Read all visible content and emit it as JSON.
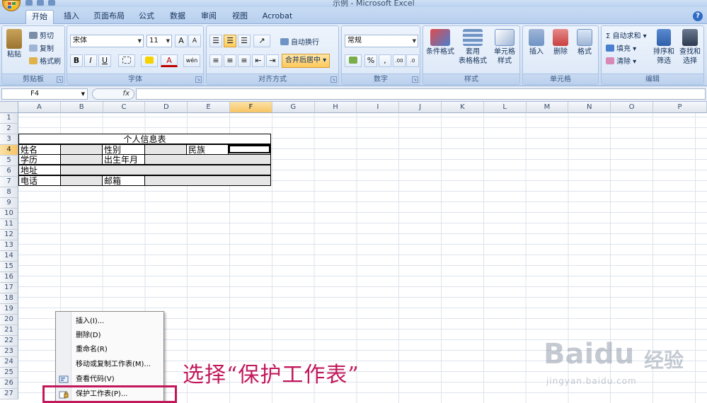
{
  "window": {
    "title": "示例 - Microsoft Excel"
  },
  "tabs": [
    {
      "label": "开始",
      "active": true
    },
    {
      "label": "插入"
    },
    {
      "label": "页面布局"
    },
    {
      "label": "公式"
    },
    {
      "label": "数据"
    },
    {
      "label": "审阅"
    },
    {
      "label": "视图"
    },
    {
      "label": "Acrobat"
    }
  ],
  "help_label": "?",
  "ribbon": {
    "clipboard": {
      "label": "剪贴板",
      "paste": "粘贴",
      "cut": "剪切",
      "copy": "复制",
      "format_painter": "格式刷"
    },
    "font": {
      "label": "字体",
      "font_name": "宋体",
      "font_size": "11",
      "bold": "B",
      "italic": "I",
      "underline": "U",
      "grow": "A",
      "shrink": "A",
      "font_color": "A",
      "phonetic": "wén"
    },
    "alignment": {
      "label": "对齐方式",
      "wrap_text": "自动换行",
      "merge_center": "合并后居中"
    },
    "number": {
      "label": "数字",
      "format": "常规",
      "percent": "%",
      "comma": ",",
      "inc_decimal": ".00",
      "dec_decimal": ".0"
    },
    "styles": {
      "label": "样式",
      "conditional": "条件格式",
      "table_line1": "套用",
      "table_line2": "表格格式",
      "cell_line1": "单元格",
      "cell_line2": "样式"
    },
    "cells": {
      "label": "单元格",
      "insert": "插入",
      "delete": "删除",
      "format": "格式"
    },
    "editing": {
      "label": "编辑",
      "autosum": "自动求和",
      "fill": "填充",
      "clear": "清除",
      "sort_line1": "排序和",
      "sort_line2": "筛选",
      "find_line1": "查找和",
      "find_line2": "选择"
    }
  },
  "formula_bar": {
    "name_box": "F4",
    "fx": "fx",
    "content": ""
  },
  "columns": [
    "A",
    "B",
    "C",
    "D",
    "E",
    "F",
    "G",
    "H",
    "I",
    "J",
    "K",
    "L",
    "M",
    "N",
    "O",
    "P"
  ],
  "selected_column": "F",
  "rows": [
    "1",
    "2",
    "3",
    "4",
    "5",
    "6",
    "7",
    "8",
    "9",
    "10",
    "11",
    "12",
    "13",
    "14",
    "15",
    "16",
    "17",
    "18",
    "19",
    "20",
    "21",
    "22",
    "23",
    "24",
    "25",
    "26",
    "27"
  ],
  "selected_row": "4",
  "sheet": {
    "title": "个人信息表",
    "name_label": "姓名",
    "gender_label": "性别",
    "ethnicity_label": "民族",
    "education_label": "学历",
    "birth_label": "出生年月",
    "address_label": "地址",
    "phone_label": "电话",
    "email_label": "邮箱"
  },
  "context_menu": [
    {
      "label": "插入(I)..."
    },
    {
      "label": "删除(D)"
    },
    {
      "label": "重命名(R)"
    },
    {
      "label": "移动或复制工作表(M)..."
    },
    {
      "label": "查看代码(V)"
    },
    {
      "label": "保护工作表(P)..."
    }
  ],
  "annotation": "选择“保护工作表”",
  "watermark": {
    "brand": "Baidu",
    "brand_cn": "经验",
    "url": "jingyan.baidu.com"
  },
  "colors": {
    "accent": "#c2185b",
    "selected_header": "#f7c463",
    "ribbon": "#d3e1f4"
  }
}
